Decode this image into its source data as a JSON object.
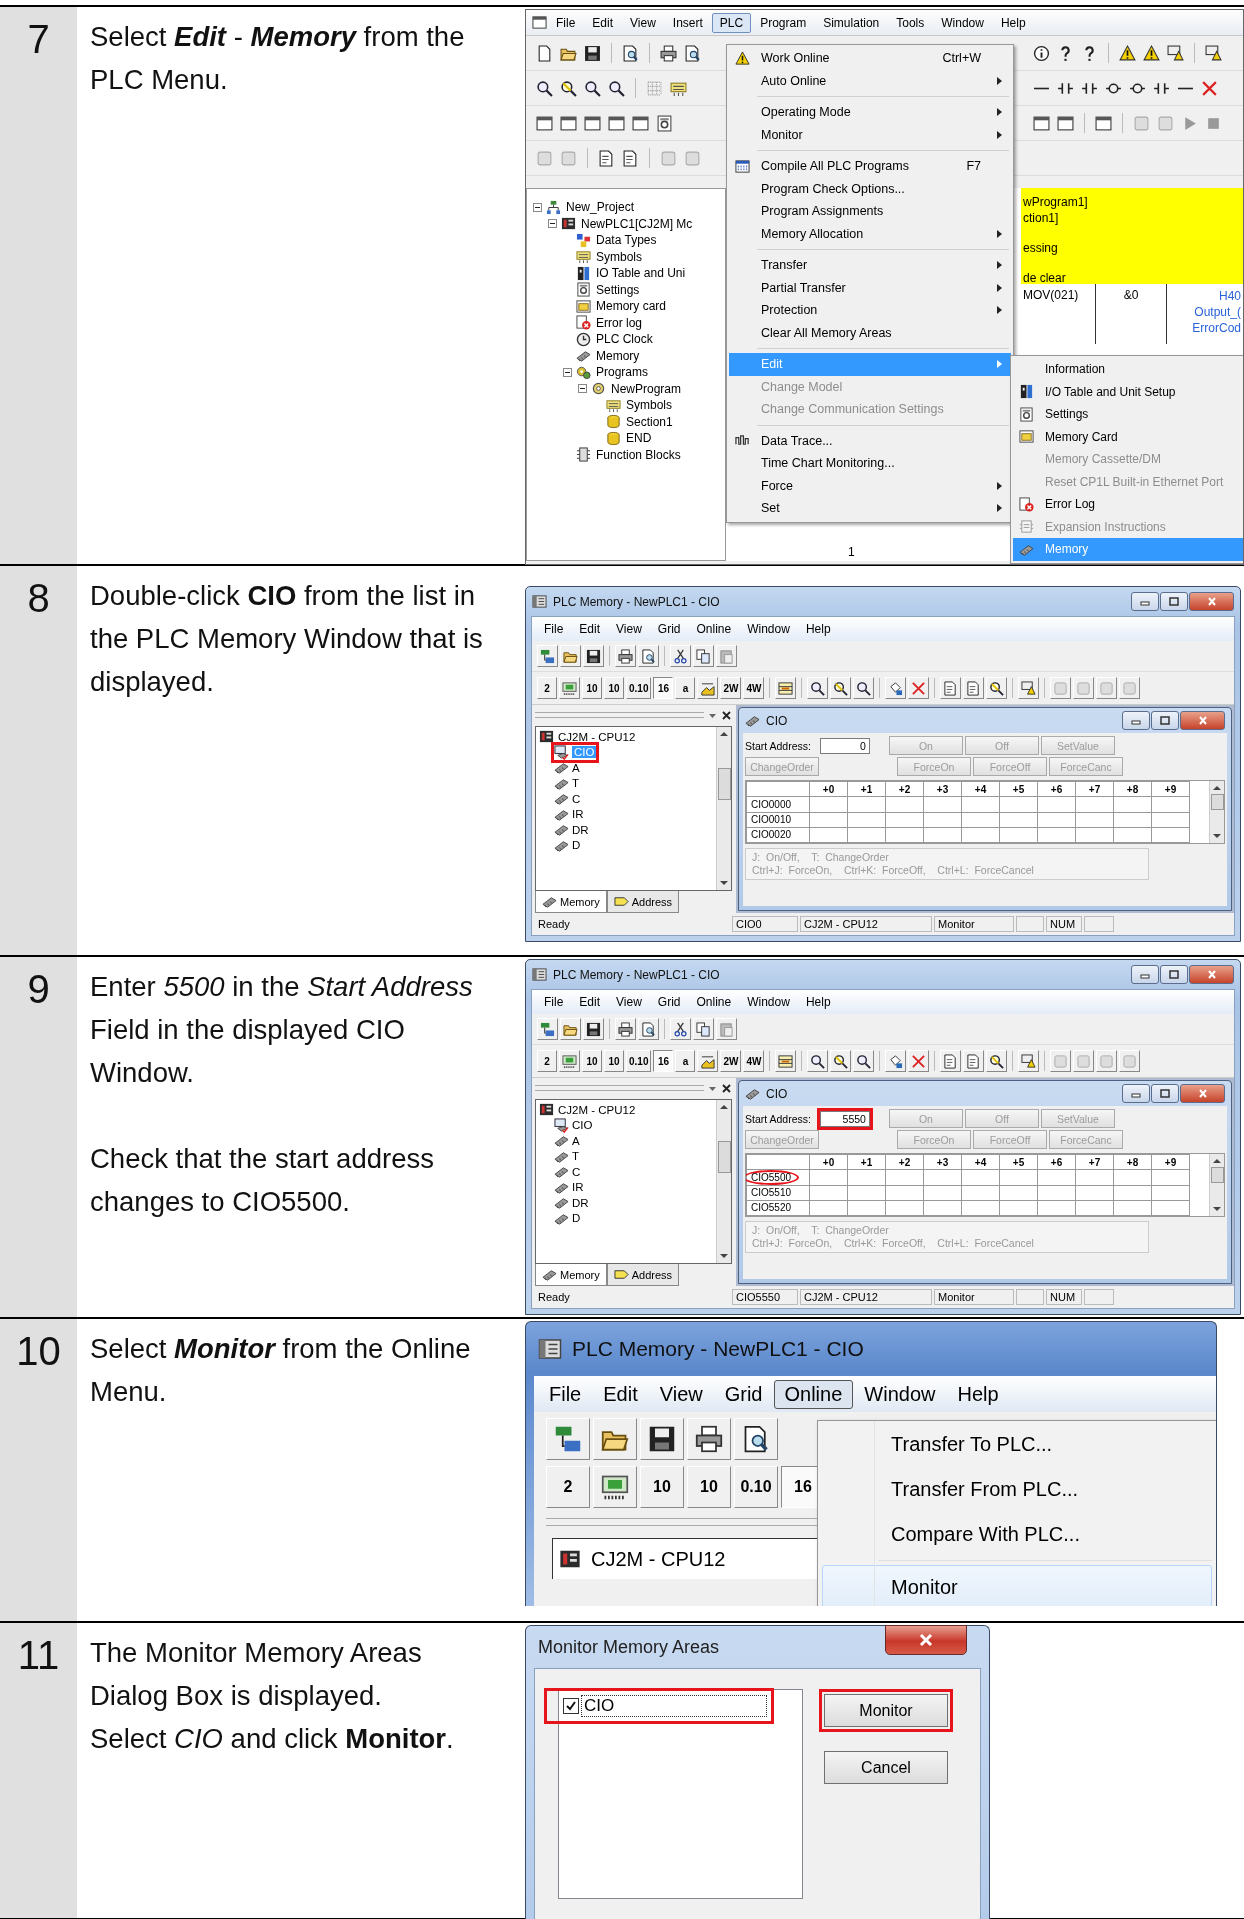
{
  "steps": [
    {
      "number": "7",
      "instruction": [
        [
          {
            "text": "Select ",
            "kind": "plain"
          },
          {
            "text": "Edit",
            "kind": "bold-italic"
          },
          {
            "text": " - ",
            "kind": "plain"
          },
          {
            "text": "Memory",
            "kind": "bold-italic"
          },
          {
            "text": " from the PLC Menu.",
            "kind": "plain"
          }
        ]
      ],
      "screen": {
        "kind": "project-window",
        "menubar": [
          {
            "label": "File",
            "selected": false
          },
          {
            "label": "Edit",
            "selected": false
          },
          {
            "label": "View",
            "selected": false
          },
          {
            "label": "Insert",
            "selected": false
          },
          {
            "label": "PLC",
            "selected": true
          },
          {
            "label": "Program",
            "selected": false
          },
          {
            "label": "Simulation",
            "selected": false
          },
          {
            "label": "Tools",
            "selected": false
          },
          {
            "label": "Window",
            "selected": false
          },
          {
            "label": "Help",
            "selected": false
          }
        ],
        "tree": [
          {
            "label": "New_Project",
            "kind": "project",
            "expanded": true,
            "children": [
              {
                "label": "NewPLC1[CJ2M] Mc",
                "kind": "plc",
                "expanded": true,
                "children": [
                  {
                    "label": "Data Types",
                    "kind": "datatypes"
                  },
                  {
                    "label": "Symbols",
                    "kind": "symbols"
                  },
                  {
                    "label": "IO Table and Uni",
                    "kind": "io"
                  },
                  {
                    "label": "Settings",
                    "kind": "settings"
                  },
                  {
                    "label": "Memory card",
                    "kind": "card"
                  },
                  {
                    "label": "Error log",
                    "kind": "error"
                  },
                  {
                    "label": "PLC Clock",
                    "kind": "clock"
                  },
                  {
                    "label": "Memory",
                    "kind": "memory"
                  },
                  {
                    "label": "Programs",
                    "kind": "programs",
                    "expanded": true,
                    "children": [
                      {
                        "label": "NewProgram",
                        "kind": "program",
                        "expanded": true,
                        "children": [
                          {
                            "label": "Symbols",
                            "kind": "symbols"
                          },
                          {
                            "label": "Section1",
                            "kind": "section"
                          },
                          {
                            "label": "END",
                            "kind": "section"
                          }
                        ]
                      }
                    ]
                  },
                  {
                    "label": "Function Blocks",
                    "kind": "fb"
                  }
                ]
              }
            ]
          }
        ],
        "ladder": {
          "comment_lines": [
            "wProgram1]",
            "ction1]",
            "essing",
            "de clear"
          ],
          "instruction": "MOV(021)",
          "operand": "&0",
          "output_lines": [
            "H40",
            "Output_(",
            "ErrorCod"
          ],
          "rung_number": "1"
        },
        "menu": [
          [
            {
              "label": "Work Online",
              "kind": "warning",
              "shortcut": "Ctrl+W",
              "has_submenu": false,
              "disabled": false,
              "selected": false
            },
            {
              "label": "Auto Online",
              "kind": "plain",
              "has_submenu": true,
              "disabled": false,
              "selected": false
            }
          ],
          [
            {
              "label": "Operating Mode",
              "kind": "plain",
              "has_submenu": true,
              "disabled": false,
              "selected": false
            },
            {
              "label": "Monitor",
              "kind": "plain",
              "has_submenu": true,
              "disabled": false,
              "selected": false
            }
          ],
          [
            {
              "label": "Compile All PLC Programs",
              "kind": "compile",
              "shortcut": "F7",
              "has_submenu": false,
              "disabled": false,
              "selected": false
            },
            {
              "label": "Program Check Options...",
              "kind": "plain",
              "has_submenu": false,
              "disabled": false,
              "selected": false
            },
            {
              "label": "Program Assignments",
              "kind": "plain",
              "has_submenu": false,
              "disabled": false,
              "selected": false
            },
            {
              "label": "Memory Allocation",
              "kind": "plain",
              "has_submenu": true,
              "disabled": false,
              "selected": false
            }
          ],
          [
            {
              "label": "Transfer",
              "kind": "plain",
              "has_submenu": true,
              "disabled": false,
              "selected": false
            },
            {
              "label": "Partial Transfer",
              "kind": "plain",
              "has_submenu": true,
              "disabled": false,
              "selected": false
            },
            {
              "label": "Protection",
              "kind": "plain",
              "has_submenu": true,
              "disabled": false,
              "selected": false
            },
            {
              "label": "Clear All Memory Areas",
              "kind": "plain",
              "has_submenu": false,
              "disabled": false,
              "selected": false
            }
          ],
          [
            {
              "label": "Edit",
              "kind": "plain",
              "has_submenu": true,
              "disabled": false,
              "selected": true
            },
            {
              "label": "Change Model",
              "kind": "plain",
              "has_submenu": false,
              "disabled": true,
              "selected": false
            },
            {
              "label": "Change Communication Settings",
              "kind": "plain",
              "has_submenu": false,
              "disabled": true,
              "selected": false
            }
          ],
          [
            {
              "label": "Data Trace...",
              "kind": "trace",
              "has_submenu": false,
              "disabled": false,
              "selected": false
            },
            {
              "label": "Time Chart Monitoring...",
              "kind": "plain",
              "has_submenu": false,
              "disabled": false,
              "selected": false
            },
            {
              "label": "Force",
              "kind": "plain",
              "has_submenu": true,
              "disabled": false,
              "selected": false
            },
            {
              "label": "Set",
              "kind": "plain",
              "has_submenu": true,
              "disabled": false,
              "selected": false
            }
          ]
        ],
        "submenu": [
          {
            "label": "Information",
            "kind": "plain",
            "disabled": false,
            "selected": false
          },
          {
            "label": "I/O Table and Unit Setup",
            "kind": "io",
            "disabled": false,
            "selected": false
          },
          {
            "label": "Settings",
            "kind": "settings",
            "disabled": false,
            "selected": false
          },
          {
            "label": "Memory Card",
            "kind": "card",
            "disabled": false,
            "selected": false
          },
          {
            "label": "Memory Cassette/DM",
            "kind": "plain",
            "disabled": true,
            "selected": false
          },
          {
            "label": "Reset CP1L Built-in Ethernet Port",
            "kind": "plain",
            "disabled": true,
            "selected": false
          },
          {
            "label": "Error Log",
            "kind": "error",
            "disabled": false,
            "selected": false
          },
          {
            "label": "Expansion Instructions",
            "kind": "expansion",
            "disabled": true,
            "selected": false
          },
          {
            "label": "Memory",
            "kind": "memory",
            "disabled": false,
            "selected": true
          }
        ]
      }
    },
    {
      "number": "8",
      "instruction": [
        "Double-click **CIO** from the list in the PLC Memory Window that is displayed."
      ],
      "screen": {
        "kind": "memory-window",
        "title": "PLC Memory - NewPLC1 - CIO",
        "menubar": [
          {
            "label": "File",
            "selected": false
          },
          {
            "label": "Edit",
            "selected": false
          },
          {
            "label": "View",
            "selected": false
          },
          {
            "label": "Grid",
            "selected": false
          },
          {
            "label": "Online",
            "selected": false
          },
          {
            "label": "Window",
            "selected": false
          },
          {
            "label": "Help",
            "selected": false
          }
        ],
        "format_buttons": [
          {
            "kind": "text",
            "label": "2",
            "selected": false
          },
          {
            "kind": "bcd",
            "selected": false
          },
          {
            "kind": "text",
            "label": "10",
            "selected": false
          },
          {
            "kind": "text",
            "label": "10",
            "selected": false
          },
          {
            "kind": "text",
            "label": "0.10",
            "selected": false
          },
          {
            "kind": "text",
            "label": "16",
            "selected": true
          },
          {
            "kind": "text",
            "label": "a",
            "selected": false
          },
          {
            "kind": "scaled",
            "selected": false
          },
          {
            "kind": "text",
            "label": "2W",
            "selected": false
          },
          {
            "kind": "text",
            "label": "4W",
            "selected": false
          }
        ],
        "tree_root": "CJ2M - CPU12",
        "tree": [
          {
            "label": "CIO",
            "kind": "monitored",
            "selected": true,
            "highlighted": true
          },
          {
            "label": "A",
            "kind": "memory",
            "selected": false,
            "highlighted": false
          },
          {
            "label": "T",
            "kind": "memory",
            "selected": false,
            "highlighted": false
          },
          {
            "label": "C",
            "kind": "memory",
            "selected": false,
            "highlighted": false
          },
          {
            "label": "IR",
            "kind": "memory",
            "selected": false,
            "highlighted": false
          },
          {
            "label": "DR",
            "kind": "memory",
            "selected": false,
            "highlighted": false
          },
          {
            "label": "D",
            "kind": "memory",
            "selected": false,
            "highlighted": false
          }
        ],
        "pane_tabs": [
          {
            "label": "Memory",
            "kind": "memory",
            "selected": true
          },
          {
            "label": "Address",
            "kind": "address",
            "selected": false
          }
        ],
        "child": {
          "title": "CIO",
          "start_address_label": "Start Address:",
          "start_address": "0",
          "start_address_highlighted": false,
          "buttons": [
            {
              "label": "On",
              "disabled": true
            },
            {
              "label": "Off",
              "disabled": true
            },
            {
              "label": "SetValue",
              "disabled": true
            },
            {
              "label": "ChangeOrder",
              "disabled": true
            },
            {
              "label": "ForceOn",
              "disabled": true
            },
            {
              "label": "ForceOff",
              "disabled": true
            },
            {
              "label": "ForceCanc",
              "disabled": true
            }
          ],
          "columns": [
            "+0",
            "+1",
            "+2",
            "+3",
            "+4",
            "+5",
            "+6",
            "+7",
            "+8",
            "+9"
          ],
          "rows": [
            {
              "label": "CIO0000",
              "circled": false
            },
            {
              "label": "CIO0010",
              "circled": false
            },
            {
              "label": "CIO0020",
              "circled": false
            }
          ],
          "help_lines": [
            "J:  On/Off,    T:  ChangeOrder",
            "Ctrl+J:  ForceOn,    Ctrl+K:  ForceOff,    Ctrl+L:  ForceCancel"
          ]
        },
        "status": {
          "message": "Ready",
          "address": "CIO0",
          "device": "CJ2M - CPU12",
          "mode": "Monitor",
          "num_lock": "NUM"
        }
      }
    },
    {
      "number": "9",
      "instruction": [
        "Enter *5500* in the *Start Address* Field in the displayed CIO Window."
      ],
      "check": "Check that the start address changes to CIO5500.",
      "screen": {
        "kind": "memory-window",
        "title": "PLC Memory - NewPLC1 - CIO",
        "menubar": [
          {
            "label": "File",
            "selected": false
          },
          {
            "label": "Edit",
            "selected": false
          },
          {
            "label": "View",
            "selected": false
          },
          {
            "label": "Grid",
            "selected": false
          },
          {
            "label": "Online",
            "selected": false
          },
          {
            "label": "Window",
            "selected": false
          },
          {
            "label": "Help",
            "selected": false
          }
        ],
        "format_buttons": [
          {
            "kind": "text",
            "label": "2",
            "selected": false
          },
          {
            "kind": "bcd",
            "selected": false
          },
          {
            "kind": "text",
            "label": "10",
            "selected": false
          },
          {
            "kind": "text",
            "label": "10",
            "selected": false
          },
          {
            "kind": "text",
            "label": "0.10",
            "selected": false
          },
          {
            "kind": "text",
            "label": "16",
            "selected": true
          },
          {
            "kind": "text",
            "label": "a",
            "selected": false
          },
          {
            "kind": "scaled",
            "selected": false
          },
          {
            "kind": "text",
            "label": "2W",
            "selected": false
          },
          {
            "kind": "text",
            "label": "4W",
            "selected": false
          }
        ],
        "tree_root": "CJ2M - CPU12",
        "tree": [
          {
            "label": "CIO",
            "kind": "monitored",
            "selected": false,
            "highlighted": false
          },
          {
            "label": "A",
            "kind": "memory",
            "selected": false,
            "highlighted": false
          },
          {
            "label": "T",
            "kind": "memory",
            "selected": false,
            "highlighted": false
          },
          {
            "label": "C",
            "kind": "memory",
            "selected": false,
            "highlighted": false
          },
          {
            "label": "IR",
            "kind": "memory",
            "selected": false,
            "highlighted": false
          },
          {
            "label": "DR",
            "kind": "memory",
            "selected": false,
            "highlighted": false
          },
          {
            "label": "D",
            "kind": "memory",
            "selected": false,
            "highlighted": false
          }
        ],
        "pane_tabs": [
          {
            "label": "Memory",
            "kind": "memory",
            "selected": true
          },
          {
            "label": "Address",
            "kind": "address",
            "selected": false
          }
        ],
        "child": {
          "title": "CIO",
          "start_address_label": "Start Address:",
          "start_address": "5550",
          "start_address_highlighted": true,
          "buttons": [
            {
              "label": "On",
              "disabled": true
            },
            {
              "label": "Off",
              "disabled": true
            },
            {
              "label": "SetValue",
              "disabled": true
            },
            {
              "label": "ChangeOrder",
              "disabled": true
            },
            {
              "label": "ForceOn",
              "disabled": true
            },
            {
              "label": "ForceOff",
              "disabled": true
            },
            {
              "label": "ForceCanc",
              "disabled": true
            }
          ],
          "columns": [
            "+0",
            "+1",
            "+2",
            "+3",
            "+4",
            "+5",
            "+6",
            "+7",
            "+8",
            "+9"
          ],
          "rows": [
            {
              "label": "CIO5500",
              "circled": true
            },
            {
              "label": "CIO5510",
              "circled": false
            },
            {
              "label": "CIO5520",
              "circled": false
            }
          ],
          "help_lines": [
            "J:  On/Off,    T:  ChangeOrder",
            "Ctrl+J:  ForceOn,    Ctrl+K:  ForceOff,    Ctrl+L:  ForceCancel"
          ]
        },
        "status": {
          "message": "Ready",
          "address": "CIO5550",
          "device": "CJ2M - CPU12",
          "mode": "Monitor",
          "num_lock": "NUM"
        }
      }
    },
    {
      "number": "10",
      "instruction": [
        [
          {
            "text": "Select ",
            "kind": "plain"
          },
          {
            "text": "Monitor",
            "kind": "bold-italic"
          },
          {
            "text": " from the Online Menu.",
            "kind": "plain"
          }
        ]
      ],
      "screen": {
        "kind": "online-menu",
        "title": "PLC Memory - NewPLC1 - CIO",
        "menubar": [
          {
            "label": "File",
            "selected": false
          },
          {
            "label": "Edit",
            "selected": false
          },
          {
            "label": "View",
            "selected": false
          },
          {
            "label": "Grid",
            "selected": false
          },
          {
            "label": "Online",
            "selected": true
          },
          {
            "label": "Window",
            "selected": false
          },
          {
            "label": "Help",
            "selected": false
          }
        ],
        "format_buttons": [
          {
            "kind": "text",
            "label": "2",
            "selected": false
          },
          {
            "kind": "bcd",
            "selected": false
          },
          {
            "kind": "text",
            "label": "10",
            "selected": false
          },
          {
            "kind": "text",
            "label": "10",
            "selected": false
          },
          {
            "kind": "text",
            "label": "0.10",
            "selected": false
          },
          {
            "kind": "text",
            "label": "16",
            "selected": true
          }
        ],
        "tree_root": "CJ2M - CPU12",
        "menu": [
          [
            {
              "label": "Transfer To PLC...",
              "selected": false
            },
            {
              "label": "Transfer From PLC...",
              "selected": false
            },
            {
              "label": "Compare With PLC...",
              "selected": false
            }
          ],
          [
            {
              "label": "Monitor",
              "selected": true
            }
          ]
        ]
      }
    },
    {
      "number": "11",
      "instruction": [
        "The Monitor Memory Areas Dialog Box is displayed.",
        "Select *CIO* and click **Monitor**."
      ],
      "screen": {
        "kind": "dialog",
        "title": "Monitor Memory Areas",
        "list": [
          {
            "label": "CIO",
            "checked": true,
            "highlighted": true
          }
        ],
        "buttons": [
          {
            "label": "Monitor",
            "highlighted": true
          },
          {
            "label": "Cancel",
            "highlighted": false
          }
        ]
      }
    }
  ]
}
